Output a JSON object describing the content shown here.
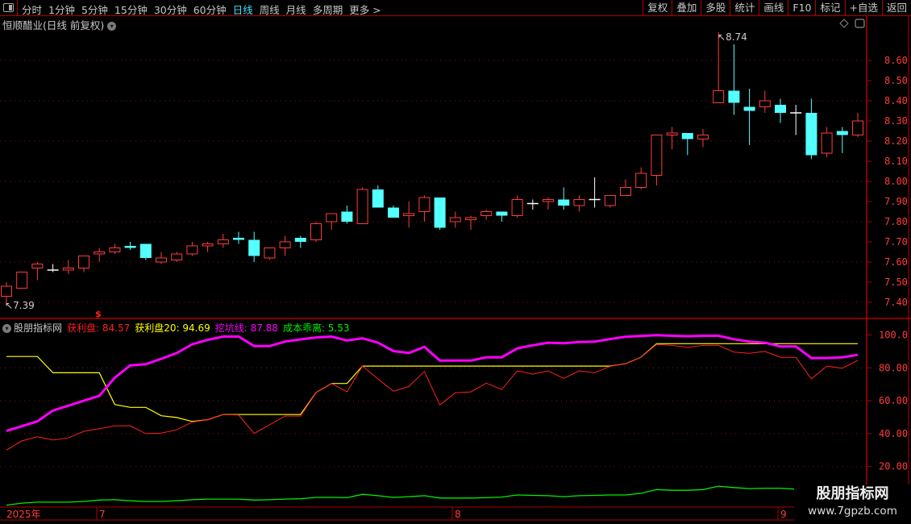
{
  "toolbar": {
    "periods": [
      "分时",
      "1分钟",
      "5分钟",
      "15分钟",
      "30分钟",
      "60分钟",
      "日线",
      "周线",
      "月线",
      "多周期",
      "更多 >"
    ],
    "active_period": "日线",
    "right_buttons": [
      "复权",
      "叠加",
      "多股",
      "统计",
      "画线",
      "F10",
      "标记",
      "+自选",
      "返回"
    ]
  },
  "title": "恒顺醋业(日线 前复权)",
  "colors": {
    "up": "#ff3c3c",
    "down": "#54ffff",
    "doji": "#ffffff",
    "profit": "#ff2020",
    "profit20": "#ffff00",
    "pit": "#ff00ff",
    "deviation": "#00ee00",
    "axis": "#b00000"
  },
  "price_axis": {
    "labels": [
      "8.60",
      "8.50",
      "8.40",
      "8.30",
      "8.20",
      "8.10",
      "8.00",
      "7.90",
      "7.80",
      "7.70",
      "7.60",
      "7.50",
      "7.40"
    ]
  },
  "markers": {
    "high": "8.74",
    "low": "7.39",
    "signal": "$"
  },
  "indicator": {
    "name": "股朋指标网",
    "legend": [
      {
        "label": "获利盘: 84.57"
      },
      {
        "label": "获利盘20: 94.69"
      },
      {
        "label": "挖坑线: 87.88"
      },
      {
        "label": "成本乖离: 5.53"
      }
    ],
    "axis_labels": [
      "100.0",
      "80.00",
      "60.00",
      "40.00",
      "20.00"
    ]
  },
  "date_axis": [
    "2025年",
    "7",
    "8",
    "9"
  ],
  "watermark": {
    "line1": "股朋指标网",
    "line2": "www.7gpzb.com"
  },
  "chart_data": [
    {
      "type": "candlestick",
      "title": "恒顺醋业(日线 前复权)",
      "ylim": [
        7.35,
        8.8
      ],
      "ohlc": [
        [
          7.43,
          7.5,
          7.39,
          7.48
        ],
        [
          7.47,
          7.55,
          7.47,
          7.55
        ],
        [
          7.57,
          7.6,
          7.51,
          7.59
        ],
        [
          7.56,
          7.59,
          7.55,
          7.56
        ],
        [
          7.56,
          7.61,
          7.54,
          7.57
        ],
        [
          7.57,
          7.63,
          7.55,
          7.63
        ],
        [
          7.64,
          7.67,
          7.6,
          7.65
        ],
        [
          7.65,
          7.69,
          7.64,
          7.67
        ],
        [
          7.68,
          7.7,
          7.66,
          7.67
        ],
        [
          7.69,
          7.69,
          7.61,
          7.62
        ],
        [
          7.6,
          7.65,
          7.59,
          7.62
        ],
        [
          7.61,
          7.65,
          7.6,
          7.64
        ],
        [
          7.64,
          7.7,
          7.63,
          7.68
        ],
        [
          7.68,
          7.7,
          7.65,
          7.69
        ],
        [
          7.69,
          7.74,
          7.67,
          7.71
        ],
        [
          7.72,
          7.75,
          7.69,
          7.71
        ],
        [
          7.71,
          7.75,
          7.6,
          7.63
        ],
        [
          7.62,
          7.67,
          7.61,
          7.67
        ],
        [
          7.67,
          7.73,
          7.63,
          7.7
        ],
        [
          7.72,
          7.73,
          7.67,
          7.7
        ],
        [
          7.71,
          7.8,
          7.7,
          7.79
        ],
        [
          7.8,
          7.84,
          7.76,
          7.84
        ],
        [
          7.85,
          7.88,
          7.79,
          7.8
        ],
        [
          7.79,
          7.97,
          7.79,
          7.96
        ],
        [
          7.96,
          7.98,
          7.87,
          7.87
        ],
        [
          7.87,
          7.88,
          7.82,
          7.82
        ],
        [
          7.83,
          7.9,
          7.77,
          7.84
        ],
        [
          7.85,
          7.93,
          7.8,
          7.92
        ],
        [
          7.92,
          7.92,
          7.76,
          7.77
        ],
        [
          7.8,
          7.85,
          7.77,
          7.82
        ],
        [
          7.81,
          7.83,
          7.76,
          7.82
        ],
        [
          7.83,
          7.86,
          7.81,
          7.85
        ],
        [
          7.85,
          7.85,
          7.8,
          7.83
        ],
        [
          7.83,
          7.93,
          7.82,
          7.91
        ],
        [
          7.89,
          7.91,
          7.86,
          7.89
        ],
        [
          7.9,
          7.92,
          7.86,
          7.91
        ],
        [
          7.91,
          7.97,
          7.86,
          7.88
        ],
        [
          7.88,
          7.93,
          7.85,
          7.91
        ],
        [
          7.91,
          8.02,
          7.87,
          7.91
        ],
        [
          7.88,
          7.93,
          7.87,
          7.93
        ],
        [
          7.93,
          8.01,
          7.93,
          7.97
        ],
        [
          7.97,
          8.07,
          7.96,
          8.04
        ],
        [
          8.03,
          8.23,
          7.98,
          8.23
        ],
        [
          8.23,
          8.27,
          8.16,
          8.24
        ],
        [
          8.24,
          8.24,
          8.13,
          8.21
        ],
        [
          8.21,
          8.26,
          8.17,
          8.23
        ],
        [
          8.39,
          8.74,
          8.39,
          8.45
        ],
        [
          8.45,
          8.68,
          8.33,
          8.39
        ],
        [
          8.37,
          8.46,
          8.18,
          8.35
        ],
        [
          8.37,
          8.45,
          8.34,
          8.4
        ],
        [
          8.38,
          8.41,
          8.29,
          8.34
        ],
        [
          8.34,
          8.38,
          8.23,
          8.34
        ],
        [
          8.34,
          8.41,
          8.11,
          8.13
        ],
        [
          8.14,
          8.27,
          8.12,
          8.24
        ],
        [
          8.25,
          8.27,
          8.14,
          8.23
        ],
        [
          8.23,
          8.34,
          8.22,
          8.3
        ]
      ]
    },
    {
      "type": "line",
      "title": "股朋指标网",
      "ylim": [
        0,
        105
      ],
      "series": [
        {
          "name": "获利盘",
          "values": [
            30,
            35.6,
            38.1,
            36.2,
            37.4,
            41.4,
            43,
            44.7,
            44.7,
            40,
            40.3,
            42.3,
            47,
            48.5,
            51.6,
            51.3,
            40.1,
            45.4,
            50.7,
            50.7,
            64.9,
            70.5,
            65.4,
            81.1,
            73.3,
            65.8,
            68.7,
            77.8,
            57.5,
            64.8,
            65.4,
            70.7,
            66.8,
            78.2,
            76.2,
            78.2,
            73.6,
            78.2,
            77,
            81,
            82.5,
            86.5,
            94.2,
            93.7,
            92.5,
            93.7,
            93.7,
            89.6,
            88.8,
            90,
            86.4,
            86.4,
            73.3,
            81.1,
            79.8,
            84.57
          ]
        },
        {
          "name": "获利盘20",
          "values": [
            86.9,
            86.9,
            86.9,
            77,
            77,
            77,
            77,
            57.7,
            56,
            56,
            50.9,
            49.8,
            47.4,
            48.5,
            51.6,
            51.6,
            51.6,
            51.6,
            51.6,
            51.6,
            65,
            70.5,
            70.5,
            81.1,
            81.1,
            81.1,
            81.1,
            81.1,
            81.1,
            81.1,
            81.1,
            81.1,
            81.1,
            81.1,
            81.1,
            81.1,
            81.1,
            81.1,
            81.1,
            81.1,
            82.5,
            86.5,
            94.69,
            94.69,
            94.69,
            94.69,
            94.69,
            94.69,
            94.69,
            94.69,
            94.69,
            94.69,
            94.69,
            94.69,
            94.69,
            94.69
          ]
        },
        {
          "name": "挖坑线",
          "values": [
            41.6,
            44.5,
            47.5,
            54,
            57,
            60,
            63,
            74,
            81.5,
            82.2,
            85.5,
            89,
            94.3,
            97,
            99,
            99,
            93.3,
            93.3,
            96,
            97.3,
            98.5,
            99,
            96.6,
            98,
            95.3,
            90.2,
            89,
            92.8,
            84.4,
            84.4,
            84.4,
            86.4,
            86.4,
            91.8,
            93.7,
            95.3,
            95,
            95.7,
            96,
            97.5,
            98.9,
            99.4,
            99.9,
            99.5,
            99.2,
            99.5,
            99.5,
            97.4,
            96,
            95.3,
            93,
            93,
            86,
            86,
            86.4,
            87.88
          ]
        },
        {
          "name": "成本乖离",
          "values": [
            0.8,
            1.4,
            1.7,
            1.7,
            1.7,
            1.9,
            2.3,
            2.4,
            2.1,
            1.9,
            1.9,
            2.1,
            2.4,
            2.6,
            2.6,
            2.6,
            2.3,
            2.4,
            2.6,
            2.7,
            3.1,
            3.1,
            3.0,
            4.0,
            3.6,
            3.1,
            3.3,
            3.6,
            2.9,
            2.9,
            2.9,
            3.0,
            3.2,
            3.8,
            3.7,
            3.6,
            3.3,
            3.6,
            3.7,
            3.8,
            3.8,
            4.3,
            5.4,
            5.2,
            5.2,
            5.4,
            6.4,
            6.0,
            5.7,
            5.8,
            5.8,
            5.53
          ]
        }
      ]
    }
  ]
}
